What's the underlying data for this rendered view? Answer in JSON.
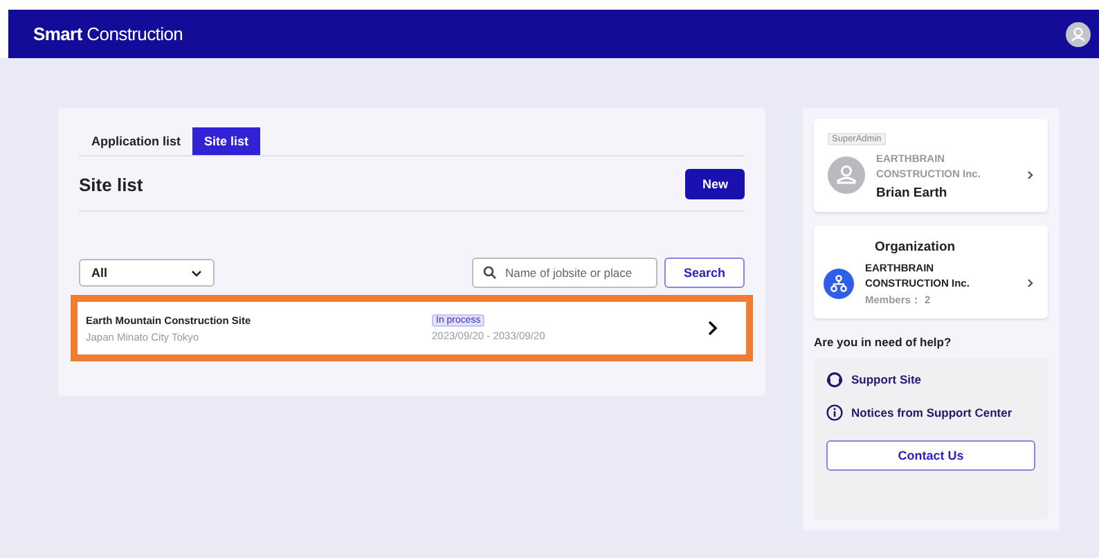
{
  "header": {
    "brand_bold": "Smart",
    "brand_rest": "Construction"
  },
  "tabs": [
    {
      "label": "Application list",
      "selected": false
    },
    {
      "label": "Site list",
      "selected": true
    }
  ],
  "title": "Site list",
  "new_button": "New",
  "filter": {
    "value": "All"
  },
  "search": {
    "placeholder": "Name of jobsite or place",
    "button": "Search"
  },
  "sites": [
    {
      "name": "Earth Mountain Construction Site",
      "location": "Japan Minato City Tokyo",
      "status": "In process",
      "period": "2023/09/20 - 2033/09/20",
      "selected": true
    }
  ],
  "account": {
    "role": "SuperAdmin",
    "company": "EARTHBRAIN CONSTRUCTION Inc.",
    "user": "Brian Earth"
  },
  "organization": {
    "title": "Organization",
    "company": "EARTHBRAIN CONSTRUCTION Inc.",
    "members": "Members： 2"
  },
  "help": {
    "title": "Are you in need of help?",
    "links": [
      {
        "kind": "support",
        "label": "Support Site"
      },
      {
        "kind": "info",
        "label": "Notices from Support Center"
      }
    ],
    "contact": "Contact Us"
  }
}
